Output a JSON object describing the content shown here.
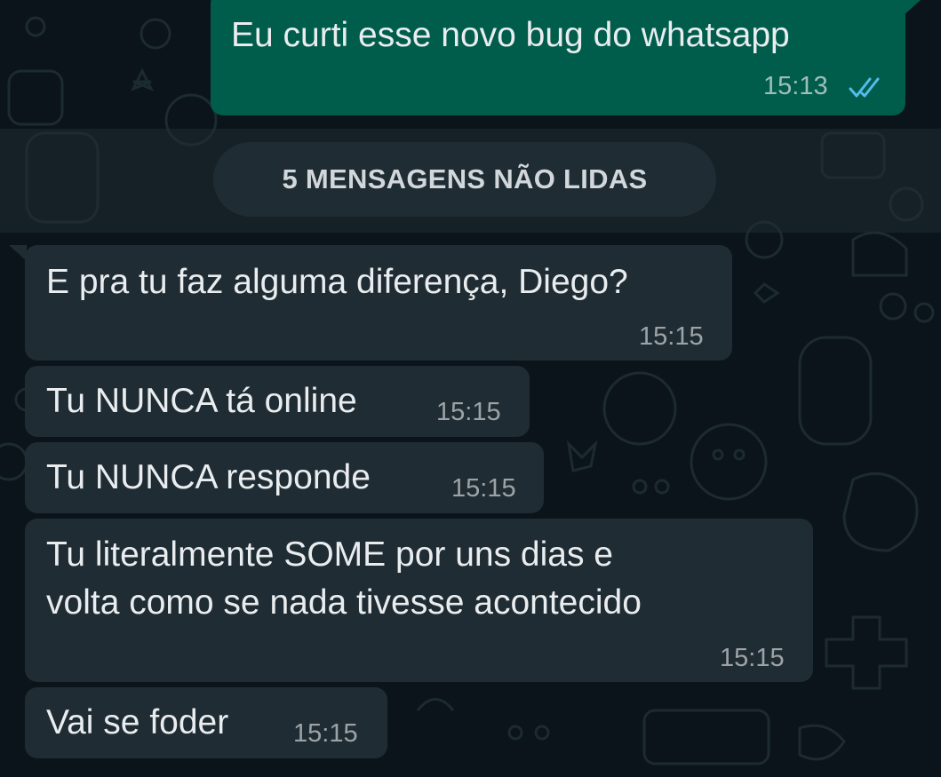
{
  "colors": {
    "background": "#0b141a",
    "incoming_bubble": "#202c33",
    "outgoing_bubble": "#005c4b",
    "read_ticks": "#53bdeb",
    "text": "#e9edef"
  },
  "icons": {
    "read_status": "double-check-icon"
  },
  "outgoing_message": {
    "text": "Eu curti esse novo bug do whatsapp",
    "time": "15:13",
    "status": "read"
  },
  "unread_banner": {
    "label": "5 MENSAGENS NÃO LIDAS"
  },
  "incoming_messages": [
    {
      "lines": [
        "E pra tu faz alguma diferença, Diego?"
      ],
      "time": "15:15"
    },
    {
      "lines": [
        "Tu NUNCA tá online"
      ],
      "time": "15:15"
    },
    {
      "lines": [
        "Tu NUNCA responde"
      ],
      "time": "15:15"
    },
    {
      "lines": [
        "Tu literalmente SOME por uns dias e",
        "volta como se nada tivesse acontecido"
      ],
      "time": "15:15"
    },
    {
      "lines": [
        "Vai se foder"
      ],
      "time": "15:15"
    }
  ]
}
